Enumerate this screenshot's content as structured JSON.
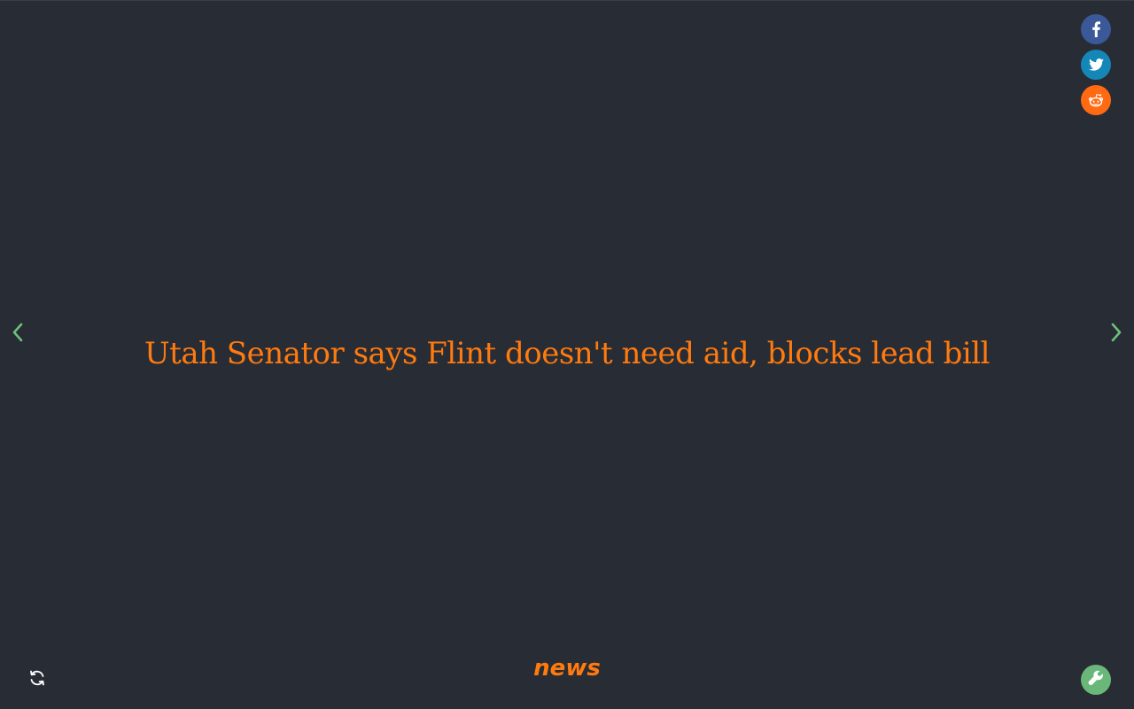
{
  "colors": {
    "background": "#282c34",
    "headline": "#ff7a0f",
    "category": "#ff7a0f",
    "nav_arrow": "#6cc07a",
    "facebook": "#3b5998",
    "twitter": "#1487b8",
    "reddit": "#ff6a13",
    "settings": "#69b879",
    "refresh": "#ffffff"
  },
  "share": {
    "icons": [
      "facebook-icon",
      "twitter-icon",
      "reddit-icon"
    ]
  },
  "navigation": {
    "prev_icon": "chevron-left-icon",
    "next_icon": "chevron-right-icon"
  },
  "story": {
    "headline": "Utah Senator says Flint doesn't need aid, blocks lead bill",
    "category": "news"
  },
  "footer": {
    "refresh_icon": "refresh-icon",
    "settings_icon": "wrench-icon"
  }
}
